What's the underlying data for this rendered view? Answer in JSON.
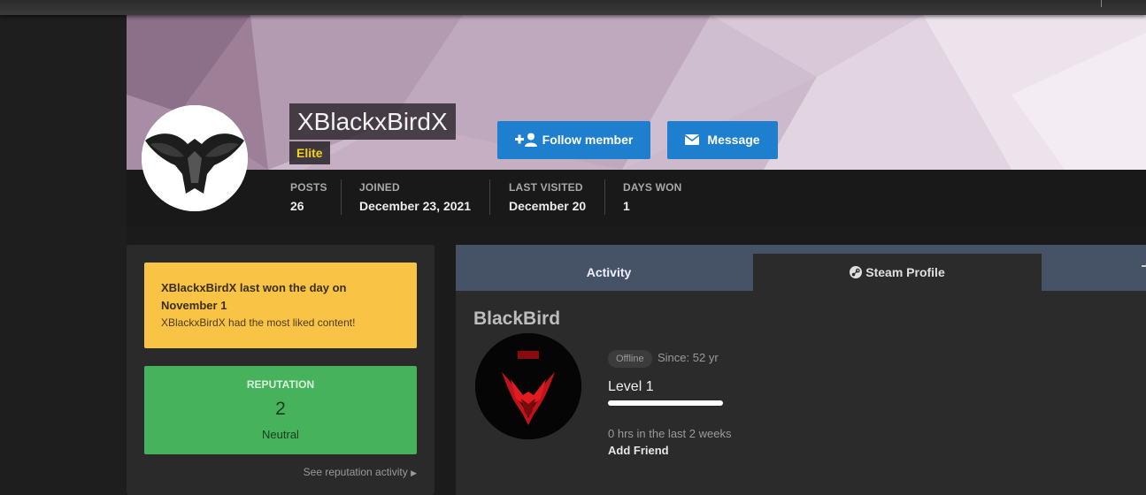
{
  "profile": {
    "username": "XBlackxBirdX",
    "rank": "Elite",
    "follow_label": "Follow member",
    "message_label": "Message",
    "colors": {
      "accent": "#1e7fcf",
      "rank": "#f2d21a"
    }
  },
  "stats": [
    {
      "label": "POSTS",
      "value": "26"
    },
    {
      "label": "JOINED",
      "value": "December 23, 2021"
    },
    {
      "label": "LAST VISITED",
      "value": "December 20"
    },
    {
      "label": "DAYS WON",
      "value": "1"
    }
  ],
  "sidebar": {
    "days_won_title": "XBlackxBirdX last won the day on November 1",
    "days_won_sub": "XBlackxBirdX had the most liked content!",
    "reputation_label": "REPUTATION",
    "reputation_value": "2",
    "reputation_word": "Neutral",
    "see_reputation": "See reputation activity"
  },
  "tabs": [
    {
      "label": "Activity",
      "active": false
    },
    {
      "label": "Steam Profile",
      "active": true,
      "icon": "steam-icon"
    }
  ],
  "steam": {
    "name": "BlackBird",
    "status": "Offline",
    "since": "Since: 52 yr",
    "level": "Level 1",
    "level_progress": 1.0,
    "hours": "0 hrs in the last 2 weeks",
    "add_friend": "Add Friend"
  }
}
